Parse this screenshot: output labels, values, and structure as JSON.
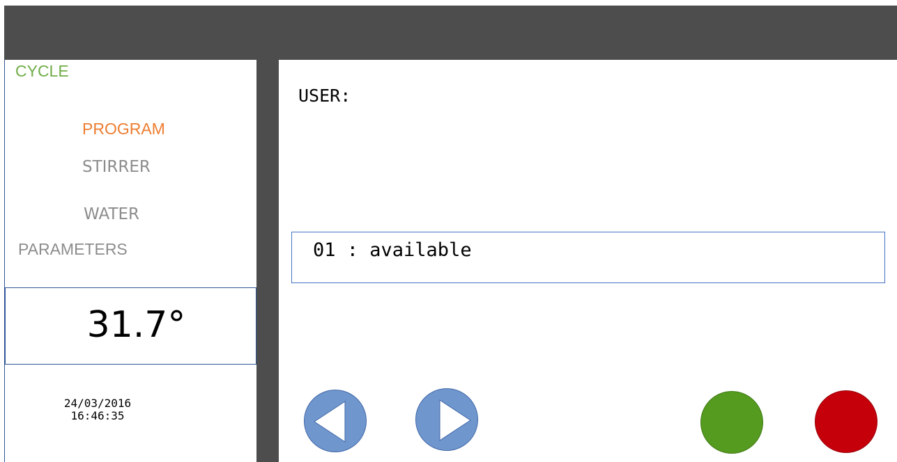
{
  "header": {
    "bar_color": "#4d4d4d"
  },
  "sidebar": {
    "section_label": "CYCLE",
    "menu": [
      {
        "label": "PROGRAM",
        "active": true
      },
      {
        "label": "STIRRER",
        "active": false
      },
      {
        "label": "WATER",
        "active": false
      },
      {
        "label": "PARAMETERS",
        "active": false
      }
    ],
    "temperature": "31.7°",
    "date": "24/03/2016",
    "time": "16:46:35"
  },
  "main": {
    "user_label": "USER:",
    "list_item": "01 : available",
    "buttons": {
      "prev_icon": "left-triangle-icon",
      "next_icon": "right-triangle-icon",
      "ok_color": "#559b1f",
      "cancel_color": "#c5000b"
    }
  },
  "colors": {
    "accent_active": "#ed7d31",
    "section_green": "#70ad47",
    "inactive_gray": "#8c8c8c",
    "nav_blue": "#7097cd"
  }
}
